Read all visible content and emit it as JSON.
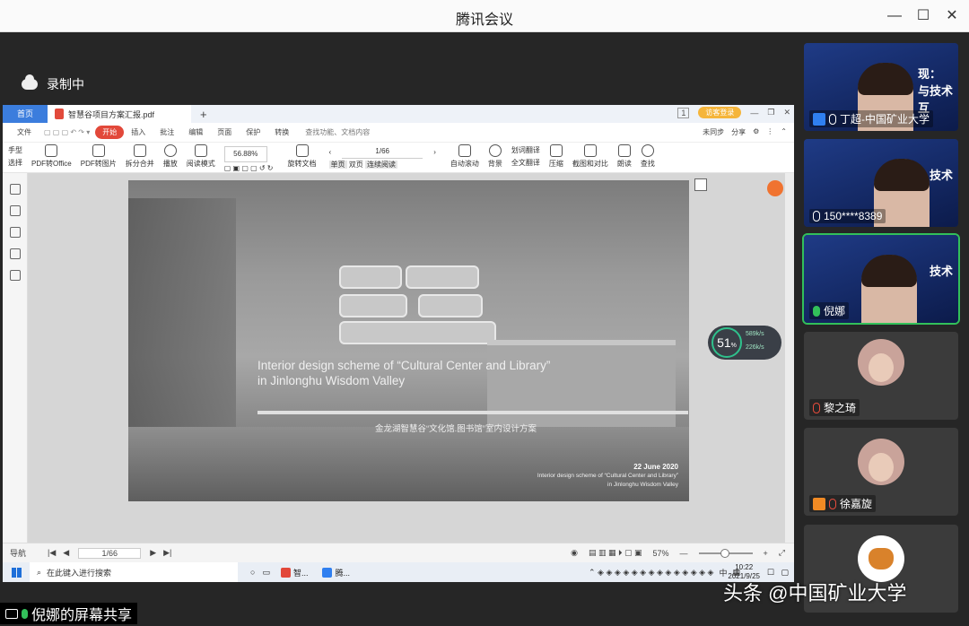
{
  "window": {
    "title": "腾讯会议",
    "min": "—",
    "max": "☐",
    "close": "✕"
  },
  "recording": {
    "label": "录制中"
  },
  "wps": {
    "tab_home": "首页",
    "doc_tab": "智慧谷项目方案汇报.pdf",
    "tab_add": "+",
    "page_badge": "1",
    "login_btn": "访客登录",
    "menu": [
      "文件",
      "开始",
      "插入",
      "批注",
      "编辑",
      "页面",
      "保护",
      "转换"
    ],
    "search_placeholder": "查找功能、文档内容",
    "menu_right": [
      "未同步",
      "分享"
    ],
    "ribbon": {
      "hand": "手型",
      "select": "选择",
      "pdf2office": "PDF转Office",
      "pdf2img": "PDF转图片",
      "split": "拆分合并",
      "play": "播放",
      "readmode": "阅读模式",
      "zoom": "56.88%",
      "rotate": "旋转文档",
      "page_indicator": "1/66",
      "single": "单页",
      "double": "双页",
      "continuous": "连续阅读",
      "autoscroll": "自动滚动",
      "eye": "背景",
      "translate": "划词翻译",
      "fulltrans": "全文翻译",
      "compress": "压缩",
      "compare": "截图和对比",
      "read": "朗读",
      "find": "查找"
    },
    "slide": {
      "title": "Interior design scheme of “Cultural Center and Library” in Jinlonghu Wisdom Valley",
      "title_cn": "金龙湖智慧谷“文化馆.图书馆”室内设计方案",
      "date": "22 June 2020",
      "sub1": "Interior design scheme of “Cultural Center and Library”",
      "sub2": "in Jinlonghu Wisdom Valley"
    },
    "speed": {
      "value": "51",
      "unit": "%",
      "up": "589k/s",
      "down": "226k/s"
    },
    "status": {
      "nav": "导航",
      "page": "1/66",
      "zoom": "57%"
    }
  },
  "taskbar": {
    "search": "在此键入进行搜索",
    "app1": "智...",
    "app2": "腾...",
    "ime": "中",
    "time": "10:22",
    "date": "2021/9/25"
  },
  "participants": [
    {
      "name": "丁超-中国矿业大学",
      "headline": "展现：\n理与技术"
    },
    {
      "name": "150****8389",
      "headline": "技术"
    },
    {
      "name": "倪娜",
      "headline": "技术"
    },
    {
      "name": "黎之琦"
    },
    {
      "name": "徐嘉旋"
    },
    {
      "name": ""
    }
  ],
  "share_label": "倪娜的屏幕共享",
  "watermark": "头条 @中国矿业大学"
}
